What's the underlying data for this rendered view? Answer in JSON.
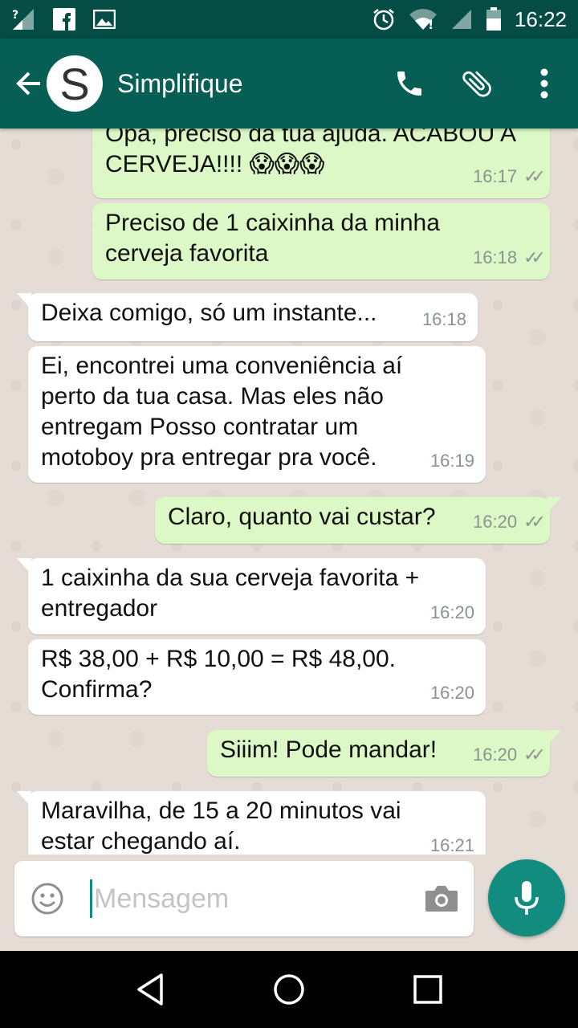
{
  "statusbar": {
    "time": "16:22"
  },
  "header": {
    "avatar_letter": "S",
    "contact_name": "Simplifique"
  },
  "messages": [
    {
      "dir": "out",
      "text": "Opa, preciso da tua ajuda. ACABOU A CERVEJA!!!! 😱😱😱",
      "time": "16:17",
      "ticks": "✓✓"
    },
    {
      "dir": "out",
      "text": "Preciso de 1 caixinha da minha cerveja favorita",
      "time": "16:18",
      "ticks": "✓✓"
    },
    {
      "dir": "in",
      "text": "Deixa comigo, só um instante...",
      "time": "16:18"
    },
    {
      "dir": "in",
      "text": "Ei, encontrei uma conveniência aí perto da tua casa. Mas eles não entregam Posso contratar um motoboy pra entregar pra você.",
      "time": "16:19"
    },
    {
      "dir": "out",
      "text": "Claro, quanto vai custar?",
      "time": "16:20",
      "ticks": "✓✓"
    },
    {
      "dir": "in",
      "text": "1 caixinha da sua cerveja favorita + entregador",
      "time": "16:20"
    },
    {
      "dir": "in",
      "text": "R$ 38,00 + R$ 10,00 = R$ 48,00. Confirma?",
      "time": "16:20"
    },
    {
      "dir": "out",
      "text": "Siiim! Pode mandar!",
      "time": "16:20",
      "ticks": "✓✓"
    },
    {
      "dir": "in",
      "text": "Maravilha, de 15 a 20 minutos vai estar chegando aí.",
      "time": "16:21"
    }
  ],
  "input": {
    "placeholder": "Mensagem"
  },
  "colors": {
    "header": "#075e54",
    "statusbar": "#054d44",
    "outgoing": "#dcf8c6",
    "incoming": "#ffffff",
    "accent": "#128c7e"
  }
}
